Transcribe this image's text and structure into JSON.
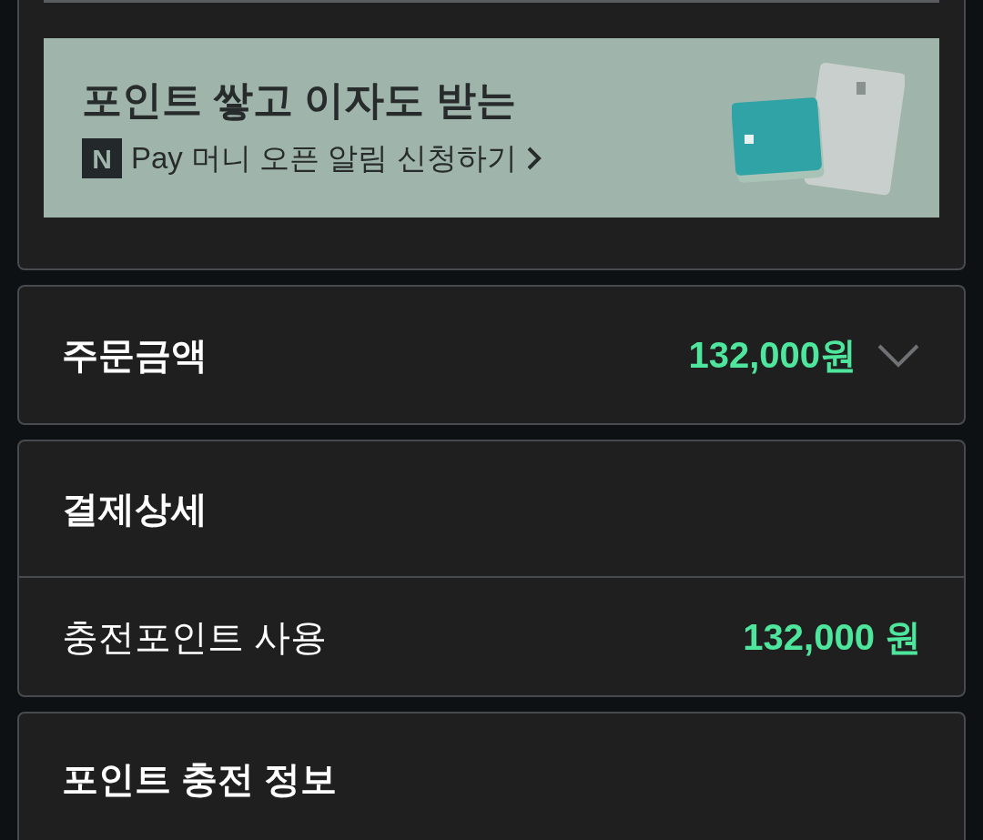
{
  "promo_banner": {
    "headline": "포인트 쌓고 이자도 받는",
    "logo_letter": "N",
    "subline": "Pay 머니 오픈 알림 신청하기"
  },
  "order_amount": {
    "label": "주문금액",
    "amount": "132,000원",
    "expanded": false
  },
  "payment_details": {
    "title": "결제상세",
    "rows": [
      {
        "label": "충전포인트 사용",
        "amount": "132,000 원"
      }
    ]
  },
  "point_charge_info": {
    "title": "포인트 충전 정보"
  }
}
